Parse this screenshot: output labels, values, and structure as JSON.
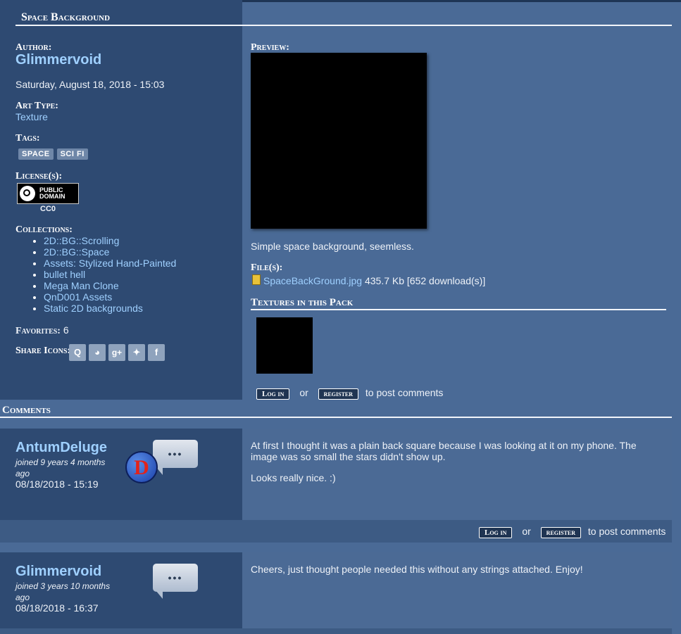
{
  "page": {
    "title": "Space Background"
  },
  "meta": {
    "author_label": "Author:",
    "author": "Glimmervoid",
    "date": "Saturday, August 18, 2018 - 15:03",
    "art_type_label": "Art Type:",
    "art_type": "Texture",
    "tags_label": "Tags:",
    "tags": [
      "SPACE",
      "SCI FI"
    ],
    "license_label": "License(s):",
    "license_badge_line1": "PUBLIC",
    "license_badge_line2": "DOMAIN",
    "license_name": "CC0",
    "collections_label": "Collections:",
    "collections": [
      "2D::BG::Scrolling",
      "2D::BG::Space",
      "Assets: Stylized Hand-Painted",
      "bullet hell",
      "Mega Man Clone",
      "QnD001 Assets",
      "Static 2D backgrounds"
    ],
    "favorites_label": "Favorites:",
    "favorites": "6",
    "share_label": "Share Icons:",
    "share_icons": [
      "qzone-icon",
      "reddit-icon",
      "google-plus-icon",
      "twitter-icon",
      "facebook-icon"
    ]
  },
  "main": {
    "preview_label": "Preview:",
    "description": "Simple space background, seemless.",
    "files_label": "File(s):",
    "file_name": "SpaceBackGround.jpg",
    "file_info": "435.7 Kb [652 download(s)]",
    "pack_title": "Textures in this Pack",
    "login_label": "Log in",
    "or_label": "or",
    "register_label": "register",
    "post_suffix": "to post comments"
  },
  "comments_title": "Comments",
  "comments": [
    {
      "author": "AntumDeluge",
      "joined": "joined 9 years 4 months ago",
      "date": "08/18/2018 - 15:19",
      "avatar_letter": "D",
      "text1": "At first I thought it was a plain back square because I was looking at it on my phone. The image was so small the stars didn't show up.",
      "text2": "Looks really nice. :)"
    },
    {
      "author": "Glimmervoid",
      "joined": "joined 3 years 10 months ago",
      "date": "08/18/2018 - 16:37",
      "text1": "Cheers, just thought people needed this without any strings attached. Enjoy!"
    }
  ],
  "colors": {
    "page_bg": "#4a6a96",
    "sidebar_bg": "#2e4a72",
    "link": "#9fd0ff"
  }
}
